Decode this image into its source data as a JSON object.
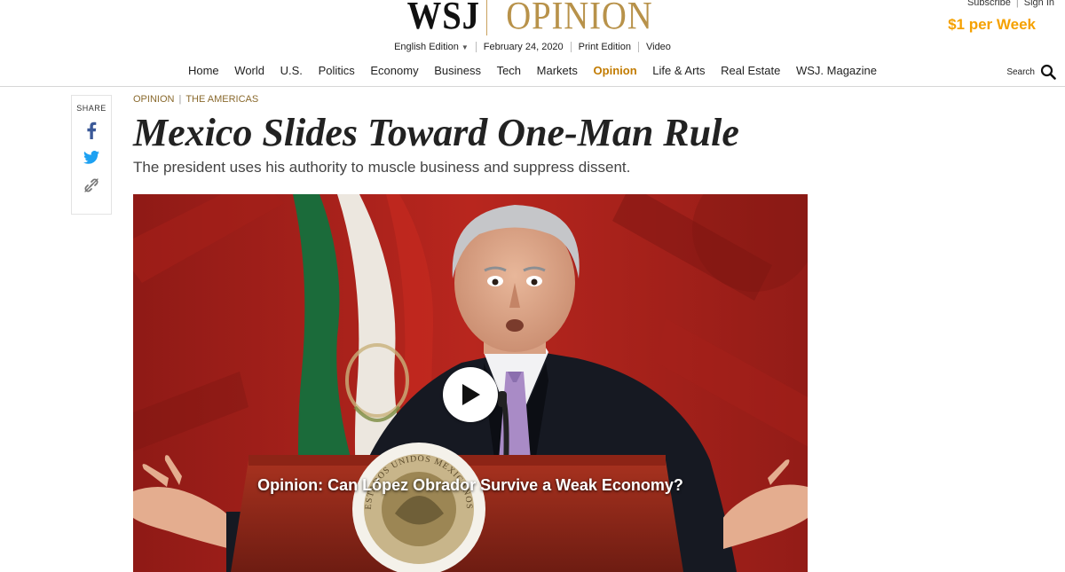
{
  "top_links": {
    "subscribe": "Subscribe",
    "signin": "Sign In"
  },
  "promo": "$1 per Week",
  "masthead": {
    "logo": "WSJ",
    "section": "OPINION"
  },
  "edition_bar": {
    "edition": "English Edition",
    "date": "February 24, 2020",
    "print": "Print Edition",
    "video": "Video"
  },
  "nav": [
    "Home",
    "World",
    "U.S.",
    "Politics",
    "Economy",
    "Business",
    "Tech",
    "Markets",
    "Opinion",
    "Life & Arts",
    "Real Estate",
    "WSJ. Magazine"
  ],
  "nav_active": "Opinion",
  "search": {
    "label": "Search",
    "icon": "search-icon"
  },
  "share": {
    "label": "SHARE",
    "icons": [
      "facebook-icon",
      "twitter-icon",
      "link-icon"
    ]
  },
  "article": {
    "kicker_section": "OPINION",
    "kicker_topic": "THE AMERICAS",
    "headline": "Mexico Slides Toward One-Man Rule",
    "dek": "The president uses his authority to muscle business and suppress dissent."
  },
  "video": {
    "caption": "Opinion: Can López Obrador Survive a Weak Economy?",
    "seal_text": "ESTADOS UNIDOS MEXICANOS"
  },
  "colors": {
    "accent_gold": "#b8924a",
    "nav_active": "#c27b00",
    "promo": "#f5a100",
    "facebook": "#3b5998",
    "twitter": "#1da1f2"
  }
}
